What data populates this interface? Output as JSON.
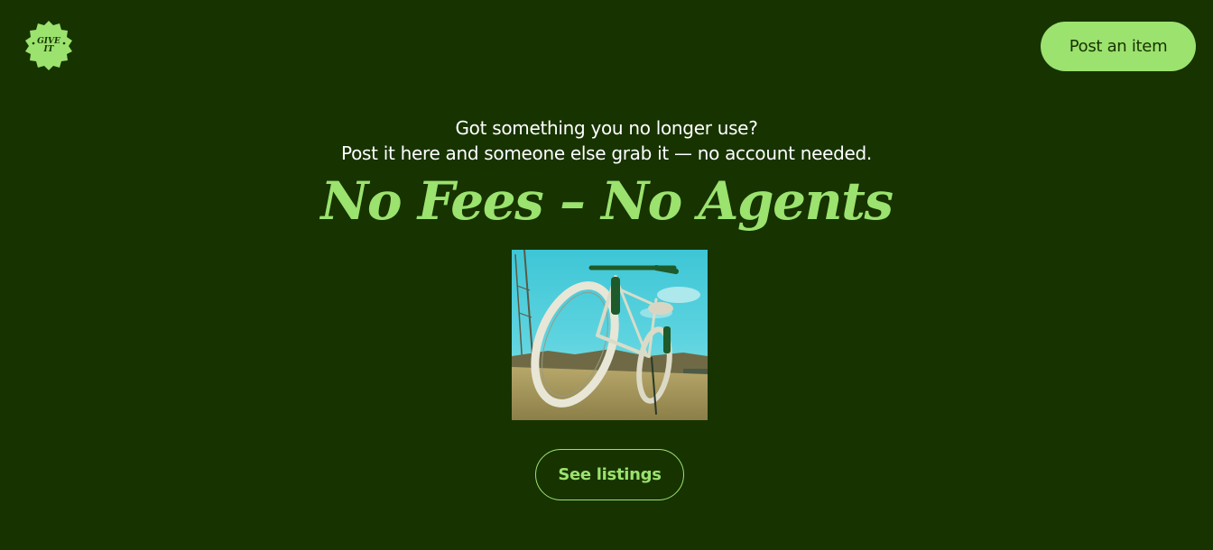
{
  "header": {
    "logo_text_line1": "GIVE",
    "logo_text_line2": "IT",
    "post_button_label": "Post an item"
  },
  "hero": {
    "tagline_line1": "Got something you no longer use?",
    "tagline_line2": "Post it here and someone else grab it — no account needed.",
    "headline": "No Fees – No Agents"
  },
  "actions": {
    "see_listings_label": "See listings"
  },
  "colors": {
    "background": "#173300",
    "accent": "#9be26e",
    "text": "#ffffff"
  }
}
